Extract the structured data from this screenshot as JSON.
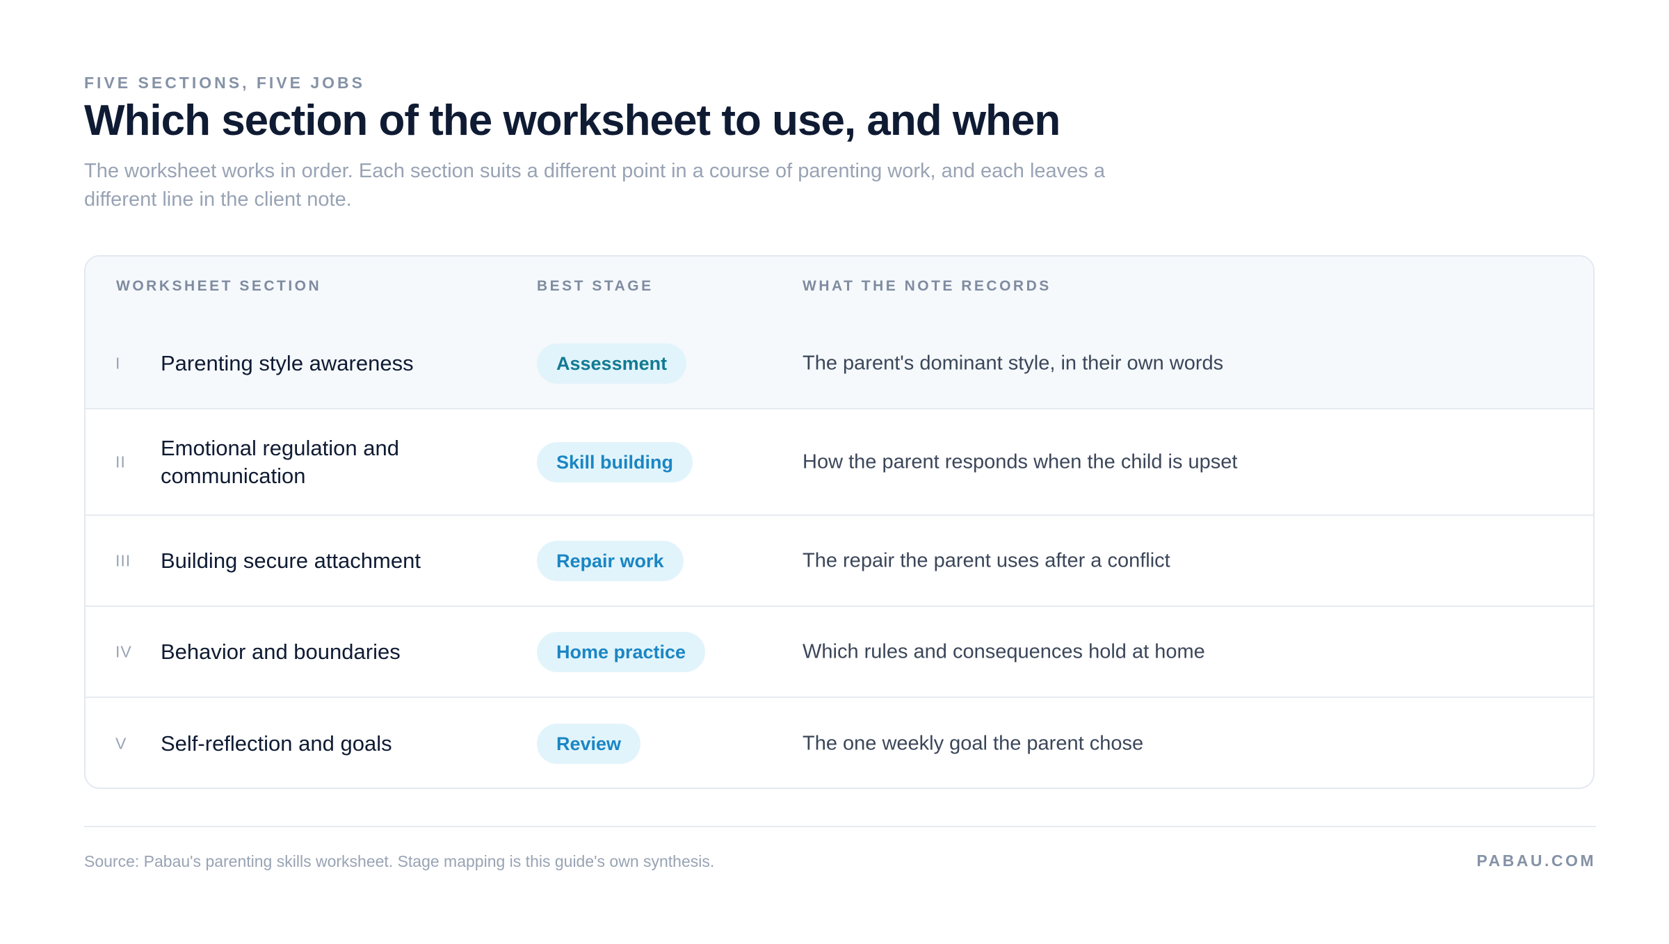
{
  "header": {
    "eyebrow": "FIVE SECTIONS, FIVE JOBS",
    "title": "Which section of the worksheet to use, and when",
    "subtitle": "The worksheet works in order. Each section suits a different point in a course of parenting work, and each leaves a different line in the client note."
  },
  "table": {
    "columns": [
      "WORKSHEET SECTION",
      "BEST STAGE",
      "WHAT THE NOTE RECORDS"
    ],
    "rows": [
      {
        "num": "I",
        "section": "Parenting style awareness",
        "stage": "Assessment",
        "note": "The parent's dominant style, in their own words"
      },
      {
        "num": "II",
        "section": "Emotional regulation and communication",
        "stage": "Skill building",
        "note": "How the parent responds when the child is upset"
      },
      {
        "num": "III",
        "section": "Building secure attachment",
        "stage": "Repair work",
        "note": "The repair the parent uses after a conflict"
      },
      {
        "num": "IV",
        "section": "Behavior and boundaries",
        "stage": "Home practice",
        "note": "Which rules and consequences hold at home"
      },
      {
        "num": "V",
        "section": "Self-reflection and goals",
        "stage": "Review",
        "note": "The one weekly goal the parent chose"
      }
    ]
  },
  "footer": {
    "source": "Source: Pabau's parenting skills worksheet. Stage mapping is this guide's own synthesis.",
    "brand": "PABAU.COM"
  },
  "colors": {
    "title": "#0f1b33",
    "muted": "#98a3b4",
    "pill_bg": "#e2f4fb",
    "pill_blue": "#1a86c4",
    "pill_teal": "#127a93",
    "header_bg": "#f5f9fc"
  }
}
